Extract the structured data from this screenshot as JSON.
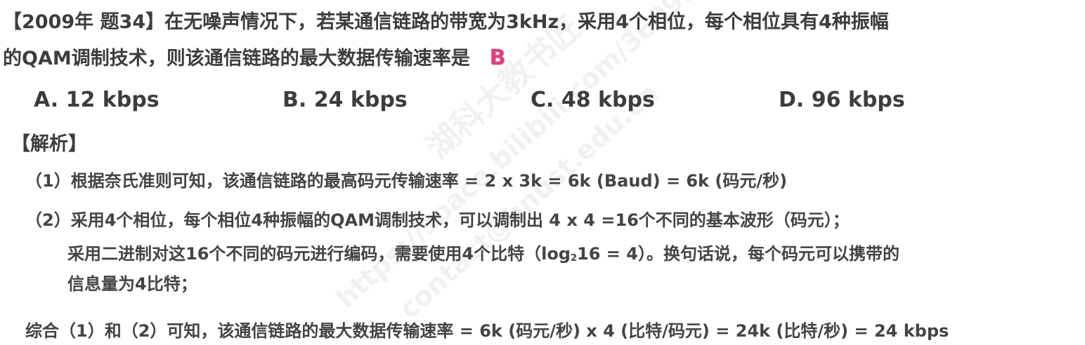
{
  "question": {
    "line1": "【2009年 题34】在无噪声情况下，若某通信链路的带宽为3kHz，采用4个相位，每个相位具有4种振幅",
    "line2": "的QAM调制技术，则该通信链路的最大数据传输速率是",
    "answer": "B"
  },
  "options": {
    "a": "A. 12 kbps",
    "b": "B. 24 kbps",
    "c": "C. 48 kbps",
    "d": "D. 96 kbps"
  },
  "analysis": {
    "heading": "【解析】",
    "step1": "（1）根据奈氏准则可知，该通信链路的最高码元传输速率 = 2 x 3k = 6k (Baud) = 6k (码元/秒)",
    "step2_line1": "（2）采用4个相位，每个相位4种振幅的QAM调制技术，可以调制出 4 x 4 =16个不同的基本波形（码元）；",
    "step2_line2_pre": "采用二进制对这16个不同的码元进行编码，需要使用4个比特（log",
    "step2_line2_sub": "2",
    "step2_line2_post": "16 = 4）。换句话说，每个码元可以携带的",
    "step2_line3": "信息量为4比特；",
    "conclusion": "综合（1）和（2）可知，该通信链路的最大数据传输速率 = 6k (码元/秒) x 4 (比特/码元) = 24k (比特/秒) = 24 kbps"
  },
  "watermarks": {
    "school": "湖科大教书匠",
    "url": "https://space.bilibili.com/360996402",
    "email": "contact@hnust.edu.cn"
  }
}
